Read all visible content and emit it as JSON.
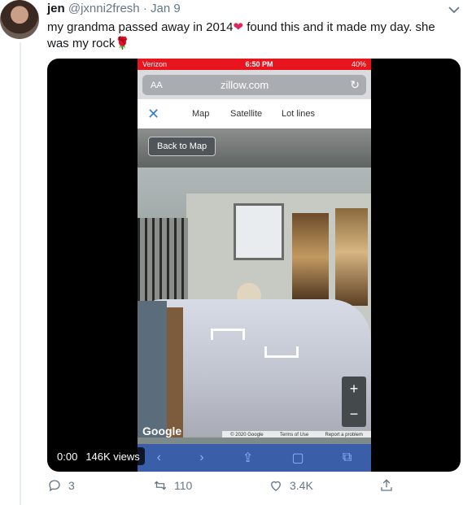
{
  "tweet": {
    "name": "jen",
    "handle": "@jxnni2fresh",
    "separator": "·",
    "date": "Jan 9",
    "text_part1": "my grandma passed away in 2014",
    "heart_emoji": "❤",
    "text_part2": " found this and it made my day. she was my rock",
    "rose_emoji": "🌹",
    "caret_icon": "chevron-down-icon"
  },
  "phone": {
    "carrier": "Verizon",
    "time": "6:50 PM",
    "battery": "40%",
    "address_aa": "AA",
    "url": "zillow.com",
    "tabs": {
      "close": "✕",
      "map": "Map",
      "satellite": "Satellite",
      "lot_lines": "Lot lines"
    },
    "back_to_map": "Back to Map",
    "zoom_in": "+",
    "zoom_out": "−",
    "google": "Google",
    "footer_copyright": "© 2020 Google",
    "footer_terms": "Terms of Use",
    "footer_report": "Report a problem"
  },
  "video": {
    "elapsed": "0:00",
    "views": "146K views"
  },
  "actions": {
    "reply_count": "3",
    "retweet_count": "110",
    "like_count": "3.4K"
  },
  "colors": {
    "accent": "#1da1f2",
    "muted": "#657786",
    "heart": "#e0245e",
    "status_red": "#e8141e"
  }
}
